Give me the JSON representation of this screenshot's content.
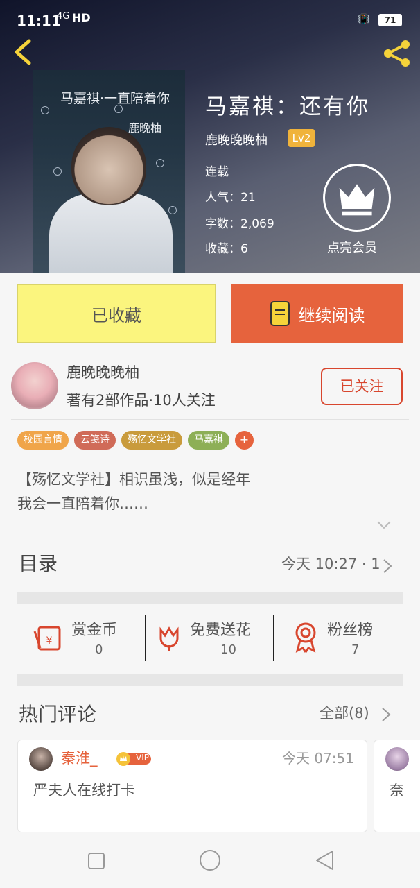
{
  "status_bar": {
    "time": "11:11",
    "signal": "4G",
    "network": "HD",
    "battery": "71"
  },
  "book": {
    "title": "马嘉祺：还有你",
    "author": "鹿晚晚晚柚",
    "level": "Lv2",
    "status": "连载",
    "popularity": "人气：21",
    "words": "字数：2,069",
    "favorites": "收藏：6",
    "cover_title": "马嘉祺·一直陪着你",
    "cover_author": "鹿晚柚"
  },
  "vip": {
    "label": "点亮会员"
  },
  "actions": {
    "favorited_label": "已收藏",
    "read_label": "继续阅读"
  },
  "author_profile": {
    "name": "鹿晚晚晚柚",
    "stats": "著有2部作品·10人关注",
    "follow_label": "已关注"
  },
  "tags": [
    {
      "label": "校园言情",
      "color": "#f0a54a"
    },
    {
      "label": "云笺诗",
      "color": "#d06b58"
    },
    {
      "label": "殇忆文学社",
      "color": "#c99b3c"
    },
    {
      "label": "马嘉祺",
      "color": "#8daf56"
    }
  ],
  "tag_add": "+",
  "description": {
    "line1": "【殇忆文学社】相识虽浅，似是经年",
    "line2": "我会一直陪着你……"
  },
  "catalog": {
    "label": "目录",
    "latest": "今天 10:27 · 1"
  },
  "support": [
    {
      "name": "赏金币",
      "value": "0",
      "icon": "red-envelope-icon"
    },
    {
      "name": "免费送花",
      "value": "10",
      "icon": "flower-icon"
    },
    {
      "name": "粉丝榜",
      "value": "7",
      "icon": "medal-icon"
    }
  ],
  "comments_section": {
    "label": "热门评论",
    "all_label": "全部(8)"
  },
  "comments": [
    {
      "user": "秦淮_",
      "badge": "VIP",
      "time": "今天 07:51",
      "text": "严夫人在线打卡"
    },
    {
      "user": "",
      "badge": "",
      "time": "",
      "text": "奈"
    }
  ],
  "colors": {
    "accent": "#e6633d",
    "favorite_bg": "#fbf57e",
    "level": "#f0b33b",
    "follow": "#d8462e"
  }
}
